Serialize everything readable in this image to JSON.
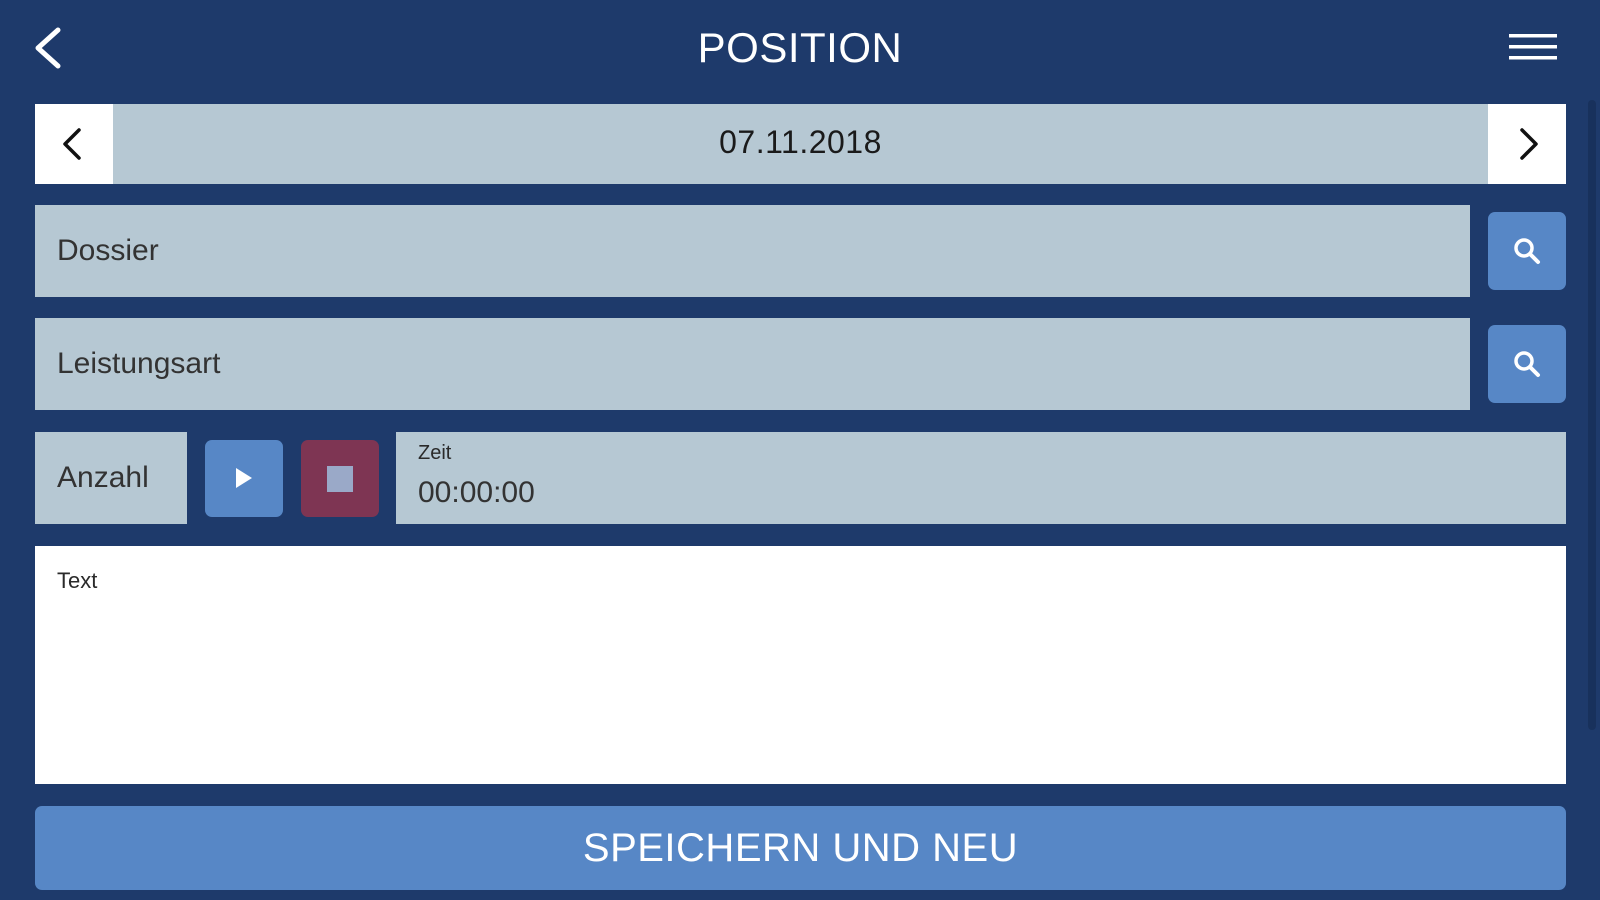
{
  "header": {
    "title": "POSITION",
    "back_icon": "chevron-left-icon",
    "menu_icon": "hamburger-menu-icon"
  },
  "date_nav": {
    "date": "07.11.2018",
    "prev_icon": "chevron-left-icon",
    "next_icon": "chevron-right-icon"
  },
  "dossier": {
    "placeholder": "Dossier",
    "value": ""
  },
  "leistungsart": {
    "placeholder": "Leistungsart",
    "value": ""
  },
  "timer": {
    "anzahl_placeholder": "Anzahl",
    "zeit_label": "Zeit",
    "zeit_value": "00:00:00"
  },
  "notes": {
    "label": "Text"
  },
  "actions": {
    "save_label": "SPEICHERN UND NEU"
  },
  "colors": {
    "background": "#1e3a6b",
    "field": "#b6c8d3",
    "accent": "#5787c6",
    "stop": "#7e3553"
  }
}
